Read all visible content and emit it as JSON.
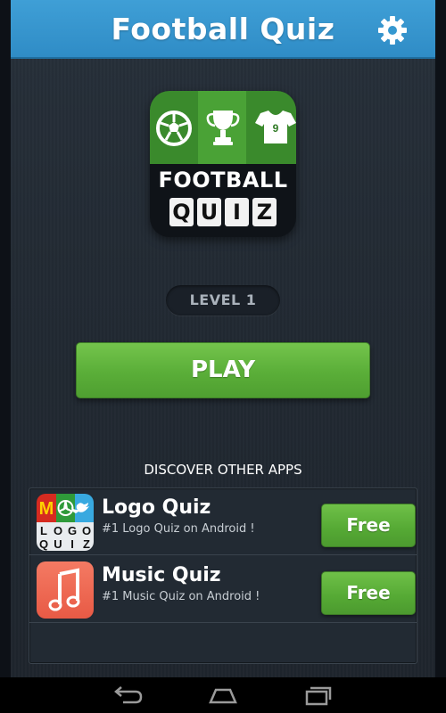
{
  "header": {
    "title": "Football Quiz",
    "settings_icon": "gear-icon"
  },
  "logo": {
    "word1": "FOOTBALL",
    "tiles": [
      "Q",
      "U",
      "I",
      "Z"
    ],
    "icons": [
      "soccer-ball-icon",
      "trophy-icon",
      "jersey-icon"
    ],
    "jersey_number": "9"
  },
  "level": {
    "label": "LEVEL 1"
  },
  "play": {
    "label": "PLAY"
  },
  "discover": {
    "title": "DISCOVER OTHER APPS",
    "apps": [
      {
        "name": "Logo Quiz",
        "description": "#1 Logo Quiz on Android !",
        "button": "Free",
        "icon": "logo-quiz-app-icon",
        "icon_tiles": [
          "L",
          "O",
          "G",
          "O",
          "Q",
          "U",
          "I",
          "Z"
        ]
      },
      {
        "name": "Music Quiz",
        "description": "#1 Music Quiz on Android !",
        "button": "Free",
        "icon": "music-note-icon"
      }
    ]
  },
  "navbar": {
    "buttons": [
      "back-icon",
      "home-icon",
      "recent-apps-icon"
    ]
  },
  "colors": {
    "title_bar": "#3f9fd6",
    "background": "#222a33",
    "play_button": "#5aae38",
    "free_button": "#55a934",
    "music_icon": "#f06a55"
  }
}
